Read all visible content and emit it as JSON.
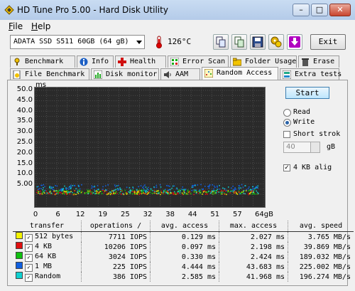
{
  "window": {
    "title": "HD Tune Pro 5.00 - Hard Disk Utility"
  },
  "menu": {
    "file": "File",
    "file_rest": "ile",
    "help": "Help",
    "help_rest": "elp"
  },
  "toolbar": {
    "drive": "ADATA SSD S511 60GB (64 gB)",
    "temperature": "126°C",
    "exit_label": "Exit"
  },
  "tabs_top": [
    "Benchmark",
    "Info",
    "Health",
    "Error Scan",
    "Folder Usage",
    "Erase"
  ],
  "tabs_bottom": [
    "File Benchmark",
    "Disk monitor",
    "AAM",
    "Random Access",
    "Extra tests"
  ],
  "options": {
    "start_label": "Start",
    "read_label": "Read",
    "write_label": "Write",
    "selected_mode": "Write",
    "short_stroke_label": "Short strok",
    "short_stroke_checked": false,
    "short_stroke_value": "40",
    "short_stroke_unit": "gB",
    "align_label": "4 KB alig",
    "align_checked": true
  },
  "chart_data": {
    "type": "scatter",
    "ylabel": "ms",
    "xlabel": "gB",
    "y_ticks": [
      "50.0",
      "45.0",
      "40.0",
      "35.0",
      "30.0",
      "25.0",
      "20.0",
      "15.0",
      "10.0",
      "5.00"
    ],
    "x_ticks": [
      "0",
      "6",
      "12",
      "19",
      "25",
      "32",
      "38",
      "44",
      "51",
      "57",
      "64gB"
    ],
    "ylim": [
      0,
      50
    ],
    "xlim": [
      0,
      64
    ],
    "grid": true,
    "series": [
      {
        "name": "512 bytes",
        "color": "#e8e800",
        "y_range": [
          0.1,
          2.0
        ]
      },
      {
        "name": "4 KB",
        "color": "#d01010",
        "y_range": [
          0.1,
          2.2
        ]
      },
      {
        "name": "64 KB",
        "color": "#10b010",
        "y_range": [
          0.3,
          2.4
        ]
      },
      {
        "name": "1 MB",
        "color": "#1060e0",
        "y_range": [
          2.0,
          5.0
        ]
      },
      {
        "name": "Random",
        "color": "#10c8c8",
        "y_range": [
          0.5,
          4.5
        ]
      }
    ]
  },
  "results": {
    "headers": [
      "transfer",
      "operations /",
      "avg. access",
      "max. access",
      "avg. speed"
    ],
    "rows": [
      {
        "transfer": "512 bytes",
        "ops": "7711 IOPS",
        "avg": "0.129 ms",
        "max": "2.027 ms",
        "speed": "3.765 MB/s",
        "color": "#f4f400"
      },
      {
        "transfer": "4 KB",
        "ops": "10206 IOPS",
        "avg": "0.097 ms",
        "max": "2.198 ms",
        "speed": "39.869 MB/s",
        "color": "#e01010"
      },
      {
        "transfer": "64 KB",
        "ops": "3024 IOPS",
        "avg": "0.330 ms",
        "max": "2.424 ms",
        "speed": "189.032 MB/s",
        "color": "#10c010"
      },
      {
        "transfer": "1 MB",
        "ops": "225 IOPS",
        "avg": "4.444 ms",
        "max": "43.683 ms",
        "speed": "225.002 MB/s",
        "color": "#1060e0"
      },
      {
        "transfer": "Random",
        "ops": "386 IOPS",
        "avg": "2.585 ms",
        "max": "41.968 ms",
        "speed": "196.274 MB/s",
        "color": "#10d0d0"
      }
    ]
  }
}
